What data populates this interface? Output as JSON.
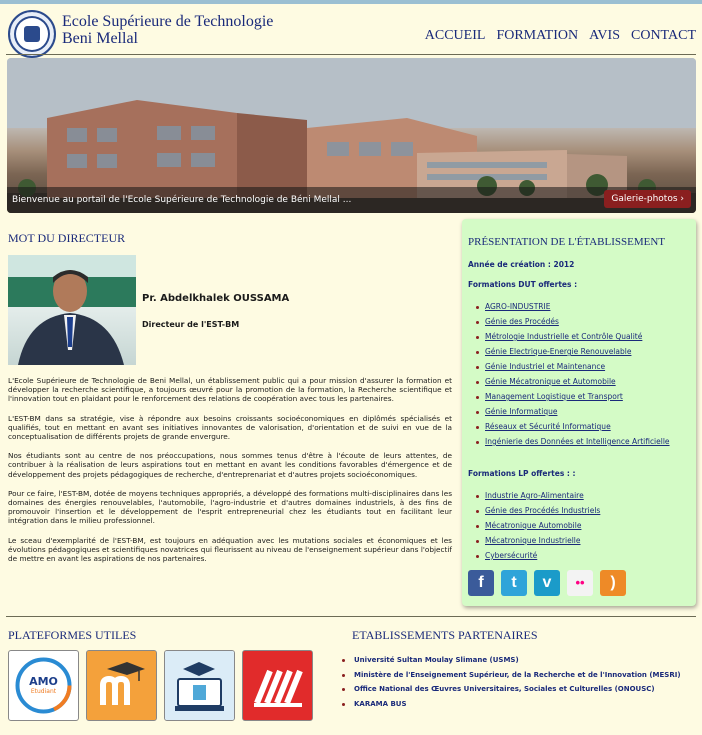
{
  "header": {
    "school_name_line1": "Ecole Supérieure de Technologie",
    "school_name_line2": "Beni Mellal",
    "nav": [
      "ACCUEIL",
      "FORMATION",
      "AVIS",
      "CONTACT"
    ]
  },
  "banner": {
    "caption": "Bienvenue au portail de l'Ecole Supérieure de Technologie de Béni Mellal ...",
    "gallery_button": "Galerie-photos ›"
  },
  "director": {
    "section_title": "MOT DU DIRECTEUR",
    "name": "Pr. Abdelkhalek OUSSAMA",
    "role": "Directeur de l'EST-BM",
    "paragraphs": [
      "L'Ecole Supérieure de Technologie de Beni Mellal, un établissement public qui a pour mission d'assurer la formation et développer la recherche scientifique, a toujours œuvré pour la promotion de la formation, la Recherche scientifique et l'innovation tout en plaidant pour le renforcement des relations de coopération avec tous les partenaires.",
      "L'EST-BM dans sa stratégie, vise à répondre aux besoins croissants socioéconomiques en diplômés spécialisés et qualifiés, tout en mettant en avant ses initiatives innovantes de valorisation, d'orientation et de suivi en vue de la conceptualisation de différents projets de grande envergure.",
      "Nos étudiants sont au centre de nos préoccupations, nous sommes tenus d'être à l'écoute de leurs attentes, de contribuer à la réalisation de leurs aspirations tout en mettant en avant les conditions favorables d'émergence et de développement des projets pédagogiques de recherche, d'entreprenariat et d'autres projets socioéconomiques.",
      "Pour ce faire, l'EST-BM, dotée de moyens techniques appropriés, a développé des formations multi-disciplinaires dans les domaines des énergies renouvelables, l'automobile, l'agro-industrie et d'autres domaines industriels, à des fins de promouvoir l'insertion et le développement de l'esprit entrepreneurial chez les étudiants tout en facilitant leur intégration dans le milieu professionnel.",
      "Le sceau d'exemplarité de l'EST-BM, est toujours en adéquation avec les mutations sociales et économiques et les évolutions pédagogiques et scientifiques novatrices qui fleurissent au niveau de l'enseignement supérieur dans l'objectif de mettre en avant les aspirations de nos partenaires."
    ]
  },
  "presentation": {
    "title": "PRÉSENTATION DE L'ÉTABLISSEMENT",
    "creation_year": "Année de création : 2012",
    "dut_heading": "Formations DUT offertes :",
    "dut": [
      "AGRO-INDUSTRIE",
      "Génie des Procédés",
      "Métrologie Industrielle et Contrôle Qualité",
      "Génie Electrique-Energie Renouvelable",
      "Génie Industriel et Maintenance",
      "Génie Mécatronique et Automobile",
      "Management Logistique et Transport",
      "Génie Informatique",
      "Réseaux et Sécurité Informatique",
      "Ingénierie des Données et Intelligence Artificielle"
    ],
    "lp_heading": "Formations LP offertes : :",
    "lp": [
      "Industrie Agro-Alimentaire",
      "Génie des Procédés Industriels",
      "Mécatronique Automobile",
      "Mécatronique Industrielle",
      "Cybersécurité"
    ],
    "social": [
      {
        "icon": "facebook-icon",
        "glyph": "f",
        "color": "#3b5b9a"
      },
      {
        "icon": "twitter-icon",
        "glyph": "t",
        "color": "#2fa4d9"
      },
      {
        "icon": "vimeo-icon",
        "glyph": "v",
        "color": "#1b9bc9"
      },
      {
        "icon": "flickr-icon",
        "glyph": "••",
        "color": "#f3f3f3"
      },
      {
        "icon": "rss-icon",
        "glyph": ")",
        "color": "#ee8a27"
      }
    ]
  },
  "platforms": {
    "title": "PLATEFORMES UTILES",
    "amo_text": "AMO",
    "amo_sub": "Etudiant"
  },
  "partners": {
    "title": "ETABLISSEMENTS PARTENAIRES",
    "items": [
      "Université Sultan Moulay Slimane (USMS)",
      "Ministère de l'Enseignement Supérieur, de la Recherche et de l'Innovation (MESRI)",
      "Office National des Œuvres Universitaires, Sociales et Culturelles (ONOUSC)",
      "KARAMA BUS"
    ]
  }
}
